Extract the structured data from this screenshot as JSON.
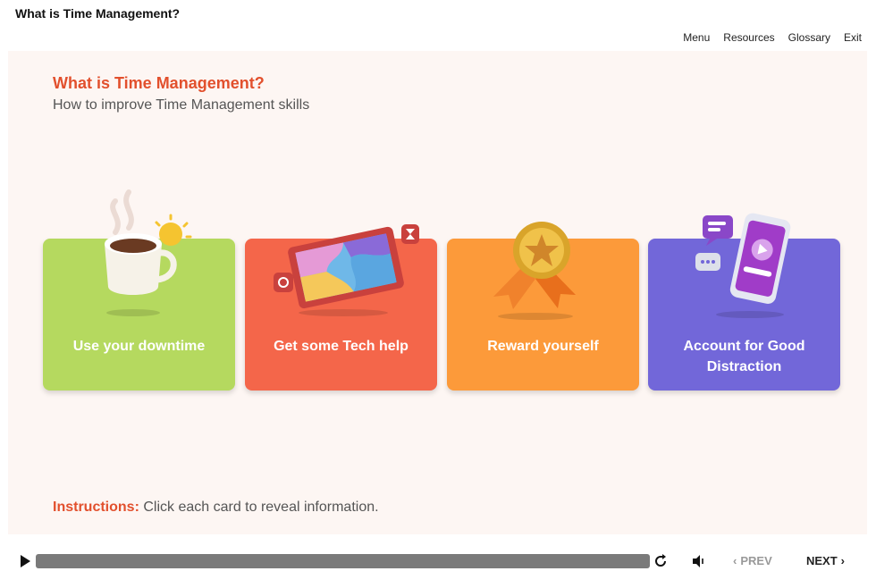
{
  "course": {
    "title": "What is Time Management?"
  },
  "nav": {
    "menu": "Menu",
    "resources": "Resources",
    "glossary": "Glossary",
    "exit": "Exit"
  },
  "slide": {
    "title": "What is Time Management?",
    "subtitle": "How to improve Time Management skills",
    "cards": [
      {
        "label": "Use your downtime",
        "color": "#b5d95f",
        "icon": "coffee-cup-icon"
      },
      {
        "label": "Get some Tech help",
        "color": "#f4664a",
        "icon": "tablet-puzzle-icon"
      },
      {
        "label": "Reward yourself",
        "color": "#fc9a3a",
        "icon": "medal-icon"
      },
      {
        "label_line1": "Account for Good",
        "label_line2": "Distraction",
        "color": "#7267d9",
        "icon": "phone-chat-icon"
      }
    ],
    "instructions_label": "Instructions:",
    "instructions_text": "Click each card to reveal information."
  },
  "player": {
    "prev_label": "PREV",
    "next_label": "NEXT"
  },
  "colors": {
    "accent": "#e2502d",
    "background": "#fdf6f3"
  }
}
